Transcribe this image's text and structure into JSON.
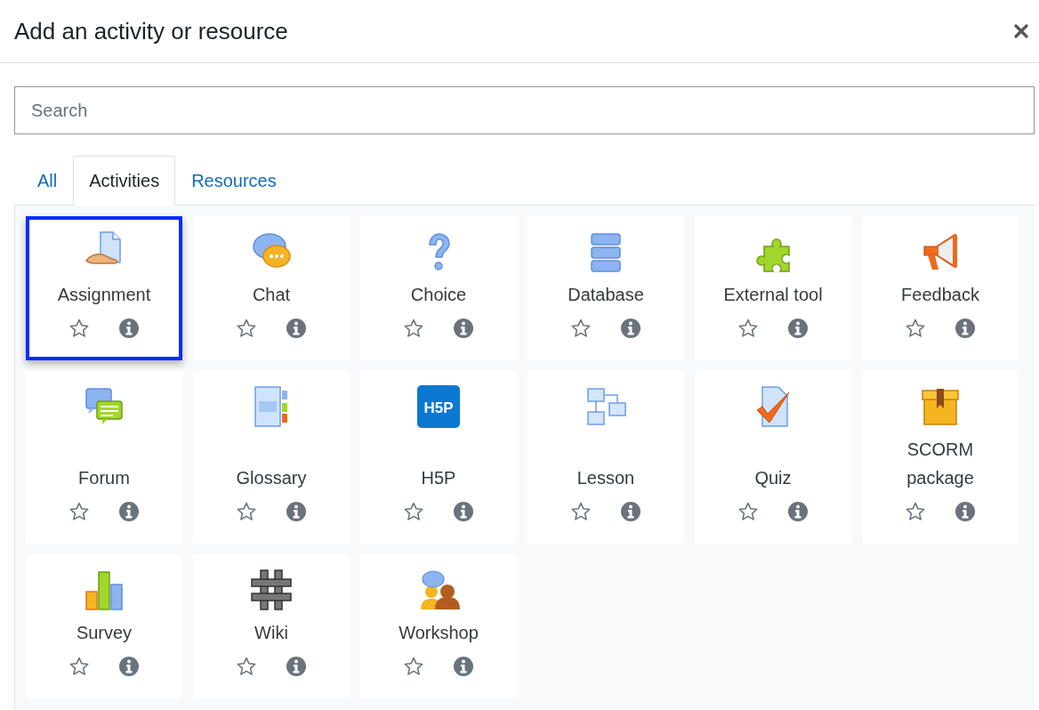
{
  "dialog": {
    "title": "Add an activity or resource"
  },
  "search": {
    "placeholder": "Search"
  },
  "tabs": [
    {
      "label": "All",
      "selected": false
    },
    {
      "label": "Activities",
      "selected": true
    },
    {
      "label": "Resources",
      "selected": false
    }
  ],
  "items": [
    {
      "label": "Assignment",
      "kind": "assignment",
      "selected": true
    },
    {
      "label": "Chat",
      "kind": "chat",
      "selected": false
    },
    {
      "label": "Choice",
      "kind": "choice",
      "selected": false
    },
    {
      "label": "Database",
      "kind": "database",
      "selected": false
    },
    {
      "label": "External tool",
      "kind": "puzzle",
      "selected": false
    },
    {
      "label": "Feedback",
      "kind": "megaphone",
      "selected": false
    },
    {
      "label": "Forum",
      "kind": "forum",
      "selected": false
    },
    {
      "label": "Glossary",
      "kind": "glossary",
      "selected": false
    },
    {
      "label": "H5P",
      "kind": "logo",
      "logo_text": "H5P",
      "selected": false
    },
    {
      "label": "Lesson",
      "kind": "lesson",
      "selected": false
    },
    {
      "label": "Quiz",
      "kind": "quiz",
      "selected": false
    },
    {
      "label": "SCORM package",
      "kind": "box",
      "selected": false
    },
    {
      "label": "Survey",
      "kind": "survey",
      "selected": false
    },
    {
      "label": "Wiki",
      "kind": "wiki",
      "selected": false
    },
    {
      "label": "Workshop",
      "kind": "workshop",
      "selected": false
    }
  ]
}
